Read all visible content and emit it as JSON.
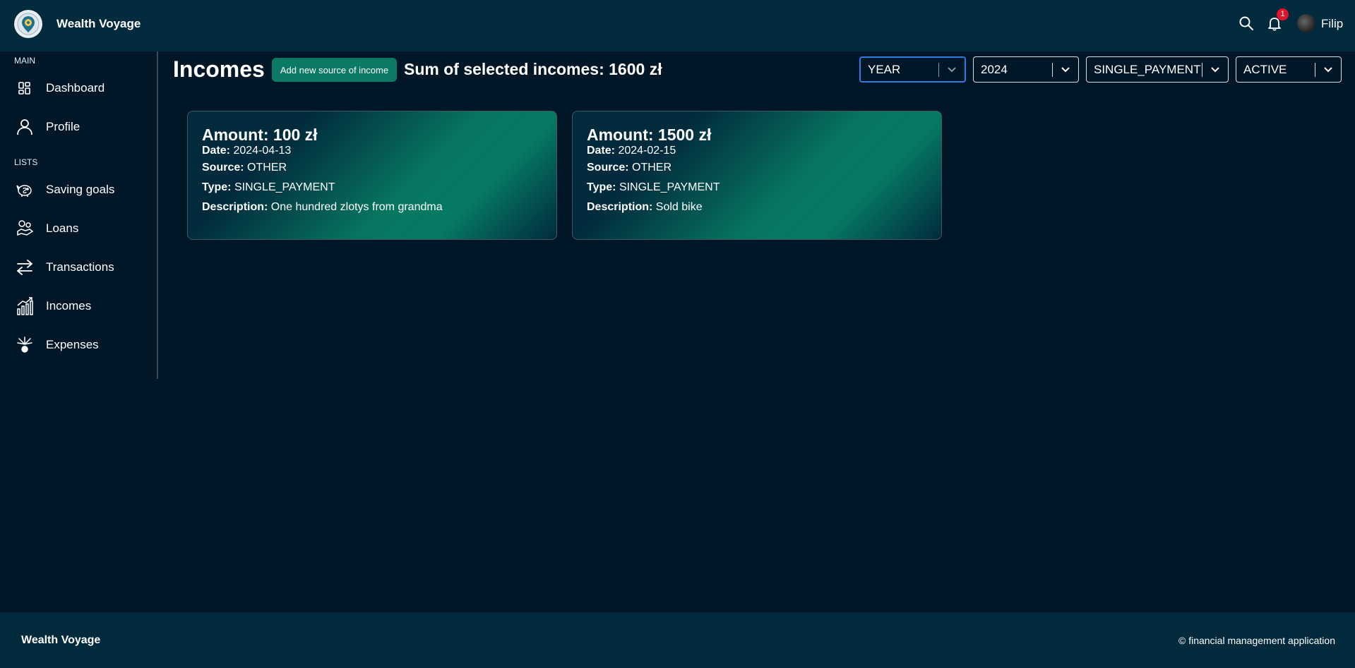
{
  "header": {
    "app_title": "Wealth Voyage",
    "notification_count": "1",
    "user_name": "Filip"
  },
  "sidebar": {
    "sections": [
      {
        "label": "MAIN",
        "items": [
          {
            "label": "Dashboard",
            "icon": "dashboard-icon"
          },
          {
            "label": "Profile",
            "icon": "user-icon"
          }
        ]
      },
      {
        "label": "LISTS",
        "items": [
          {
            "label": "Saving goals",
            "icon": "piggy-bank-icon"
          },
          {
            "label": "Loans",
            "icon": "loan-hand-icon"
          },
          {
            "label": "Transactions",
            "icon": "transfer-arrows-icon"
          },
          {
            "label": "Incomes",
            "icon": "growth-chart-icon"
          },
          {
            "label": "Expenses",
            "icon": "expense-icon"
          }
        ]
      }
    ]
  },
  "main": {
    "title": "Incomes",
    "add_button_label": "Add new source of income",
    "sum_text": "Sum of selected incomes: 1600 zł",
    "filters": [
      {
        "value": "YEAR"
      },
      {
        "value": "2024"
      },
      {
        "value": "SINGLE_PAYMENT"
      },
      {
        "value": "ACTIVE"
      }
    ],
    "cards": [
      {
        "amount": "Amount: 100 zł",
        "date_label": "Date:",
        "date": "2024-04-13",
        "source_label": "Source:",
        "source": "OTHER",
        "type_label": "Type:",
        "type": "SINGLE_PAYMENT",
        "description_label": "Description:",
        "description": "One hundred zlotys from grandma"
      },
      {
        "amount": "Amount: 1500 zł",
        "date_label": "Date:",
        "date": "2024-02-15",
        "source_label": "Source:",
        "source": "OTHER",
        "type_label": "Type:",
        "type": "SINGLE_PAYMENT",
        "description_label": "Description:",
        "description": "Sold bike"
      }
    ]
  },
  "footer": {
    "brand": "Wealth Voyage",
    "copyright": "© financial management application"
  },
  "colors": {
    "background": "#011627",
    "header_footer": "#012a3c",
    "accent": "#0b7a64",
    "badge": "#e0142a",
    "focus": "#2f7be0"
  }
}
